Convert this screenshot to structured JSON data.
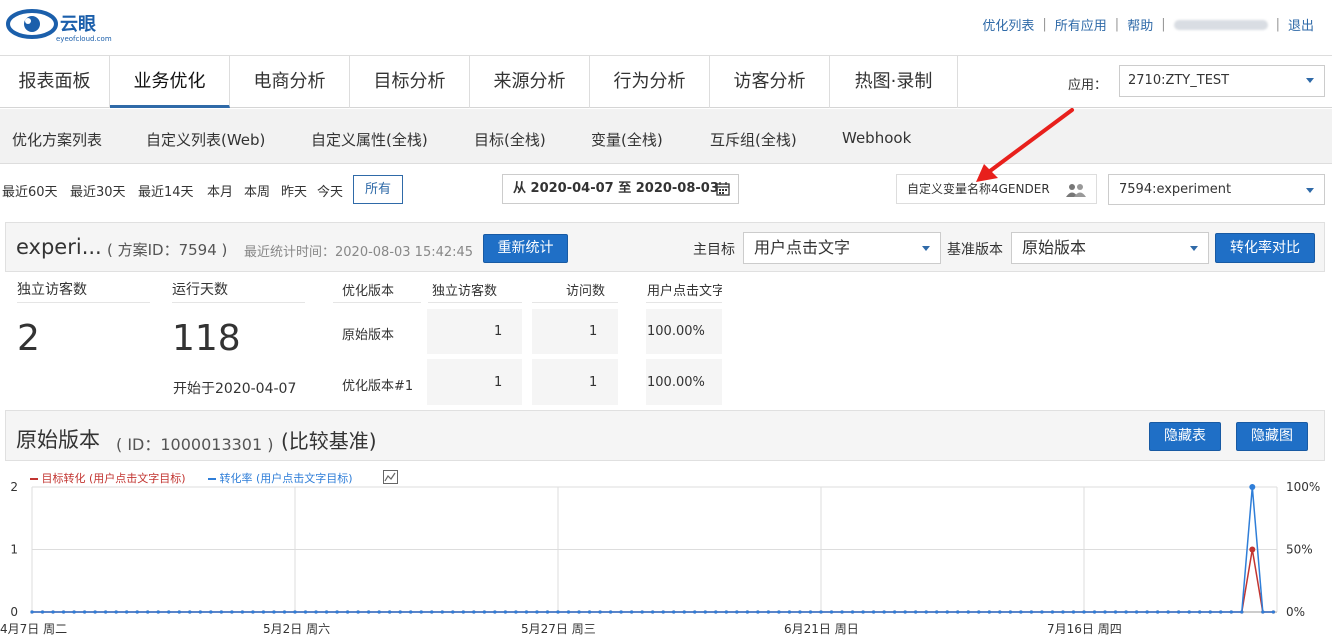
{
  "brand": {
    "name": "云眼",
    "sub": "eyeofcloud.com"
  },
  "toplinks": [
    "优化列表",
    "所有应用",
    "帮助",
    "退出"
  ],
  "mainnav": [
    "报表面板",
    "业务优化",
    "电商分析",
    "目标分析",
    "来源分析",
    "行为分析",
    "访客分析",
    "热图·录制"
  ],
  "app": {
    "label": "应用：",
    "value": "2710:ZTY_TEST"
  },
  "subnav": [
    "优化方案列表",
    "自定义列表(Web)",
    "自定义属性(全栈)",
    "目标(全栈)",
    "变量(全栈)",
    "互斥组(全栈)",
    "Webhook"
  ],
  "ranges": [
    "最近60天",
    "最近30天",
    "最近14天",
    "本月",
    "本周",
    "昨天",
    "今天"
  ],
  "all_button": "所有",
  "daterange": "从 2020-04-07 至 2020-08-03",
  "custom_var": "自定义变量名称4GENDER",
  "experiment_select": "7594:experiment",
  "experiment": {
    "name": "experi...",
    "id_text": "( 方案ID：7594 )",
    "last_stat": "最近统计时间：2020-08-03 15:42:45",
    "recount": "重新统计",
    "goal_label": "主目标",
    "goal_value": "用户点击文字",
    "base_label": "基准版本",
    "base_value": "原始版本",
    "compare": "转化率对比"
  },
  "stats": {
    "visitors_label": "独立访客数",
    "visitors": "2",
    "days_label": "运行天数",
    "days": "118",
    "started": "开始于2020-04-07"
  },
  "table": {
    "headers": [
      "优化版本",
      "独立访客数",
      "访问数",
      "用户点击文字"
    ],
    "rows": [
      [
        "原始版本",
        "1",
        "1",
        "100.00%"
      ],
      [
        "优化版本#1",
        "1",
        "1",
        "100.00%"
      ]
    ]
  },
  "variant": {
    "title": "原始版本",
    "id_text": "( ID：1000013301 )",
    "base": "(比较基准)",
    "hide_table": "隐藏表",
    "hide_chart": "隐藏图"
  },
  "chart_data": {
    "type": "line",
    "series": [
      {
        "name": "目标转化 (用户点击文字目标)",
        "color": "#c23531",
        "axis": "left",
        "spike_value": 1
      },
      {
        "name": "转化率 (用户点击文字目标)",
        "color": "#2f7ed8",
        "axis": "right",
        "spike_value": 100
      }
    ],
    "y_left_ticks": [
      "0",
      "1",
      "2"
    ],
    "y_right_ticks": [
      "0%",
      "50%",
      "100%"
    ],
    "x_ticks": [
      "4月7日 周二",
      "5月2日 周六",
      "5月27日 周三",
      "6月21日 周日",
      "7月16日 周四"
    ],
    "spike_date": "2020-08-01",
    "ylim_left": [
      0,
      2
    ],
    "ylim_right": [
      0,
      100
    ]
  }
}
